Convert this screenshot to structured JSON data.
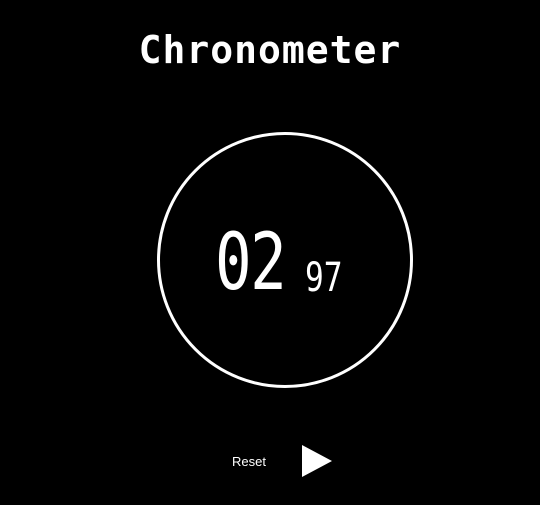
{
  "app": {
    "title": "Chronometer"
  },
  "timer": {
    "seconds": "02",
    "hundredths": "97"
  },
  "controls": {
    "reset_label": "Reset",
    "play_icon": "play-icon"
  },
  "colors": {
    "background": "#000000",
    "foreground": "#ffffff"
  }
}
